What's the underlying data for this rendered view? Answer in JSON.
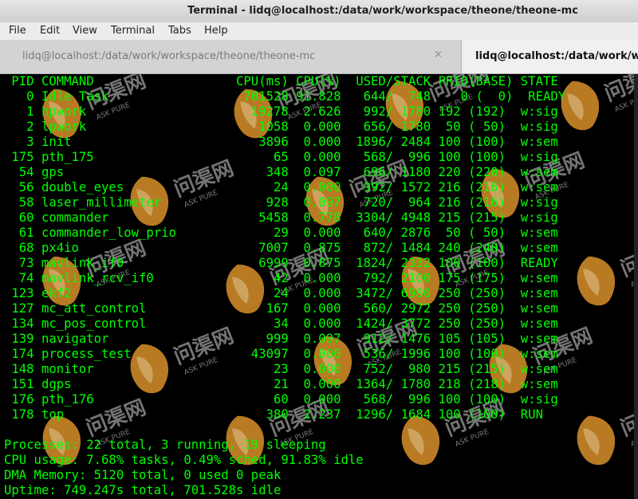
{
  "window": {
    "title": "Terminal - lidq@localhost:/data/work/workspace/theone/theone-mc"
  },
  "menu": [
    "File",
    "Edit",
    "View",
    "Terminal",
    "Tabs",
    "Help"
  ],
  "tabs": [
    {
      "label": "lidq@localhost:/data/work/workspace/theone/theone-mc",
      "close": "×"
    },
    {
      "label": "lidq@localhost:/data/work/workspace/theone/theone-mc"
    }
  ],
  "terminal": {
    "header": " PID COMMAND                   CPU(ms) CPU(%)  USED/STACK PRIO(BASE) STATE",
    "rows": [
      "   0 Idle Task                  701528 91.828   644/  748    0 (  0)  READY",
      "   1 hpwork                      19278  2.626   992/ 1780 192 (192)  w:sig",
      "   2 lpwork                       1058  0.000   656/ 1780  50 ( 50)  w:sig",
      "   3 init                         3896  0.000  1896/ 2484 100 (100)  w:sem",
      " 175 pth_175                        65  0.000   568/  996 100 (100)  w:sig",
      "  54 gps                           348  0.097   696/ 1180 220 (220)  w:sem",
      "  56 double_eyes                    24  0.000   992/ 1572 216 (216)  w:sem",
      "  58 laser_millimeter              928  0.097   720/  964 216 (216)  w:sig",
      "  60 commander                    5458  0.778  3304/ 4948 215 (215)  w:sig",
      "  61 commander_low_prio             29  0.000   640/ 2876  50 ( 50)  w:sem",
      "  68 px4io                        7007  0.875   872/ 1484 240 (240)  w:sem",
      "  73 mavlink_if0                  6999  0.875  1824/ 2332 100 (100)  READY",
      "  74 mavlink_rcv_if0                42  0.000   792/ 2100 175 (175)  w:sem",
      " 123 ekf2                           24  0.000  3472/ 6980 250 (250)  w:sem",
      " 127 mc_att_control                167  0.000   560/ 2972 250 (250)  w:sem",
      " 134 mc_pos_control                 34  0.000  1424/ 3772 250 (250)  w:sem",
      " 139 navigator                     999  0.097   912/ 1476 105 (105)  w:sem",
      " 174 process_test                43097  0.000   536/ 1996 100 (100)  w:sem",
      " 148 monitor                        23  0.000   752/  980 215 (215)  w:sem",
      " 151 dgps                           21  0.000  1364/ 1780 218 (218)  w:sem",
      " 176 pth_176                        60  0.000   568/  996 100 (100)  w:sig",
      " 178 top                           380  2.237  1296/ 1684 100 (100)  RUN"
    ],
    "summary": [
      "Processes: 22 total, 3 running, 19 sleeping",
      "CPU usage: 7.68% tasks, 0.49% sched, 91.83% idle",
      "DMA Memory: 5120 total, 0 used 0 peak",
      "Uptime: 749.247s total, 701.528s idle"
    ]
  },
  "watermark": {
    "brand": "问渠网",
    "sub": "ASK PURE",
    "color": "#d9902a"
  }
}
